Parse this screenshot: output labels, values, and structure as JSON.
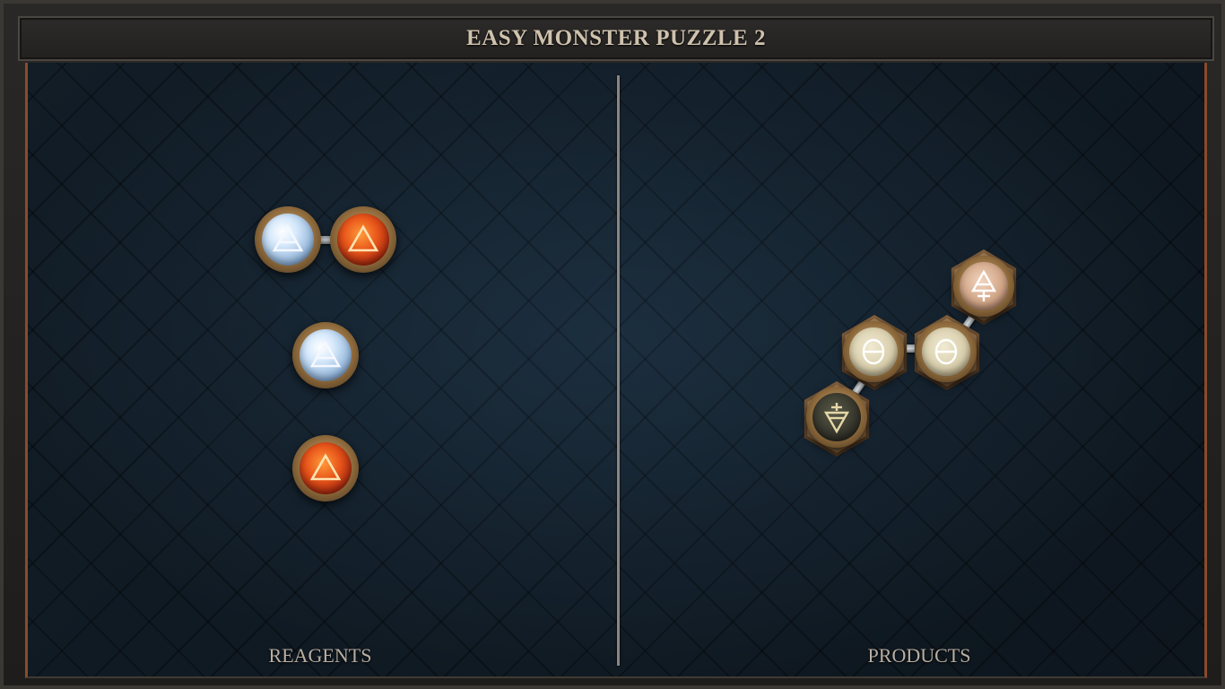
{
  "title": "EASY MONSTER PUZZLE 2",
  "panels": {
    "left_label": "REAGENTS",
    "right_label": "PRODUCTS"
  },
  "reagents": [
    {
      "molecule": 1,
      "atoms": [
        "air",
        "fire"
      ]
    },
    {
      "molecule": 2,
      "atoms": [
        "air"
      ]
    },
    {
      "molecule": 3,
      "atoms": [
        "fire"
      ]
    }
  ],
  "product": {
    "atoms": [
      "mors",
      "salt",
      "salt",
      "vitae"
    ]
  },
  "icons": {
    "air": "air-element-icon",
    "fire": "fire-element-icon",
    "salt": "salt-icon",
    "vitae": "vitae-icon",
    "mors": "mors-icon"
  },
  "colors": {
    "frame": "#3b3834",
    "board": "#1a2a38",
    "accent_border": "#8a4b2a",
    "title_text": "#cfc2ad",
    "label_text": "#b8aea1"
  }
}
